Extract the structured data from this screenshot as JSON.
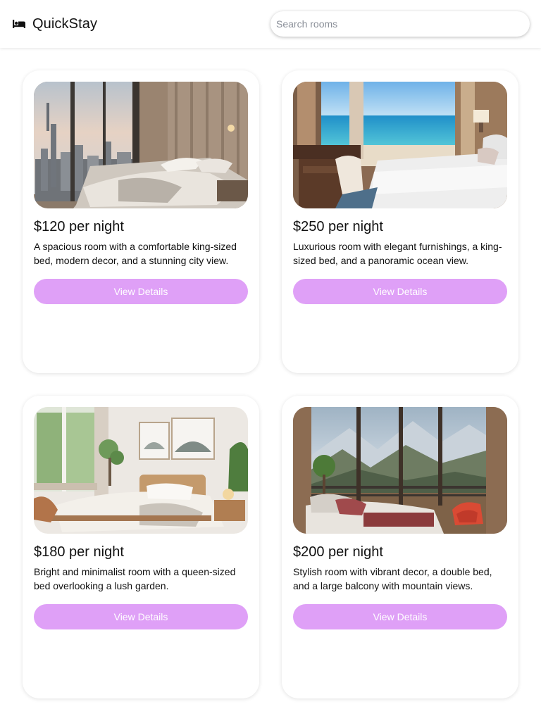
{
  "header": {
    "brand_icon": "bed-icon",
    "brand_name": "QuickStay",
    "search_placeholder": "Search rooms"
  },
  "colors": {
    "accent": "#dfa0f7",
    "button_text": "#ffffff",
    "page_background": "#ffffff"
  },
  "rooms": [
    {
      "price": "$120 per night",
      "description": "A spacious room with a comfortable king-sized bed, modern decor, and a stunning city view.",
      "button": "View Details"
    },
    {
      "price": "$250 per night",
      "description": "Luxurious room with elegant furnishings, a king-sized bed, and a panoramic ocean view.",
      "button": "View Details"
    },
    {
      "price": "$180 per night",
      "description": "Bright and minimalist room with a queen-sized bed overlooking a lush garden.",
      "button": "View Details"
    },
    {
      "price": "$200 per night",
      "description": "Stylish room with vibrant decor, a double bed, and a large balcony with mountain views.",
      "button": "View Details"
    }
  ]
}
